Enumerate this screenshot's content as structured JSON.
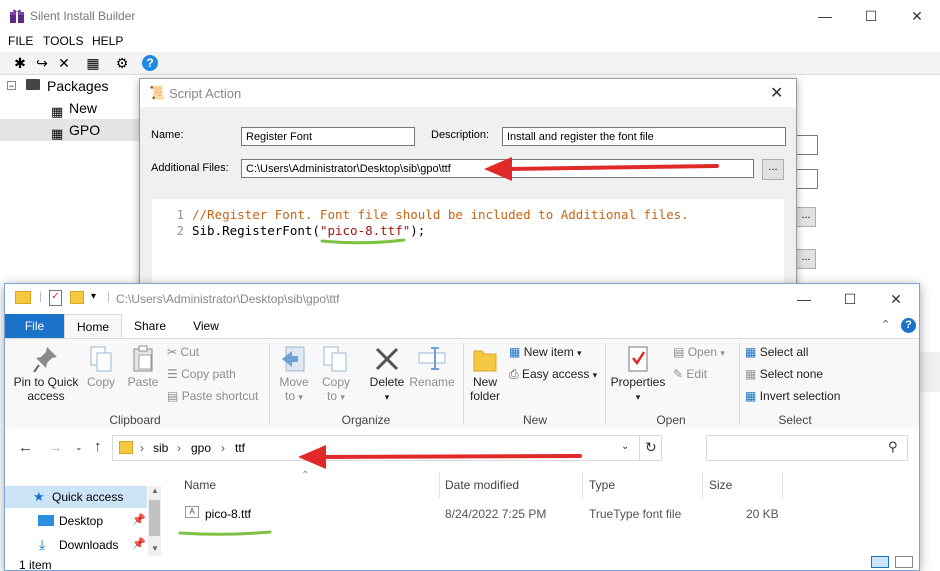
{
  "main": {
    "title": "Silent Install Builder",
    "menu": [
      "FILE",
      "TOOLS",
      "HELP"
    ],
    "tree": {
      "root": "Packages",
      "items": [
        "New Package",
        "GPO"
      ]
    }
  },
  "dialog": {
    "title": "Script Action",
    "name_label": "Name:",
    "name_value": "Register Font",
    "description_label": "Description:",
    "description_value": "Install and register the font file",
    "files_label": "Additional Files:",
    "files_value": "C:\\Users\\Administrator\\Desktop\\sib\\gpo\\ttf",
    "browse_label": "...",
    "code": {
      "line_numbers": [
        "1",
        "2"
      ],
      "line1": "//Register Font. Font file should be included to Additional files.",
      "line2_prefix": "Sib.RegisterFont(",
      "line2_string": "\"pico-8.ttf\"",
      "line2_suffix": ");"
    }
  },
  "explorer": {
    "title_path": "C:\\Users\\Administrator\\Desktop\\sib\\gpo\\ttf",
    "tabs": [
      "File",
      "Home",
      "Share",
      "View"
    ],
    "ribbon": {
      "pin_label_1": "Pin to Quick",
      "pin_label_2": "access",
      "copy": "Copy",
      "paste": "Paste",
      "cut": "Cut",
      "copy_path": "Copy path",
      "paste_shortcut": "Paste shortcut",
      "clipboard_group": "Clipboard",
      "move_to_1": "Move",
      "move_to_2": "to",
      "copy_to_1": "Copy",
      "copy_to_2": "to",
      "delete": "Delete",
      "rename": "Rename",
      "organize_group": "Organize",
      "new_folder_1": "New",
      "new_folder_2": "folder",
      "new_item": "New item",
      "easy_access": "Easy access",
      "new_group": "New",
      "properties": "Properties",
      "open": "Open",
      "edit": "Edit",
      "open_group": "Open",
      "select_all": "Select all",
      "select_none": "Select none",
      "invert_selection": "Invert selection",
      "select_group": "Select"
    },
    "address": {
      "crumbs": [
        "sib",
        "gpo",
        "ttf"
      ]
    },
    "nav": {
      "quick_access": "Quick access",
      "desktop": "Desktop",
      "downloads": "Downloads"
    },
    "columns": [
      "Name",
      "Date modified",
      "Type",
      "Size"
    ],
    "file": {
      "name": "pico-8.ttf",
      "date": "8/24/2022 7:25 PM",
      "type": "TrueType font file",
      "size": "20 KB"
    },
    "status": "1 item"
  },
  "colors": {
    "arrow": "#e02a2a",
    "underline": "#7dc142",
    "file_tab": "#1a73c9",
    "comment": "#c86414",
    "string": "#a31515"
  }
}
